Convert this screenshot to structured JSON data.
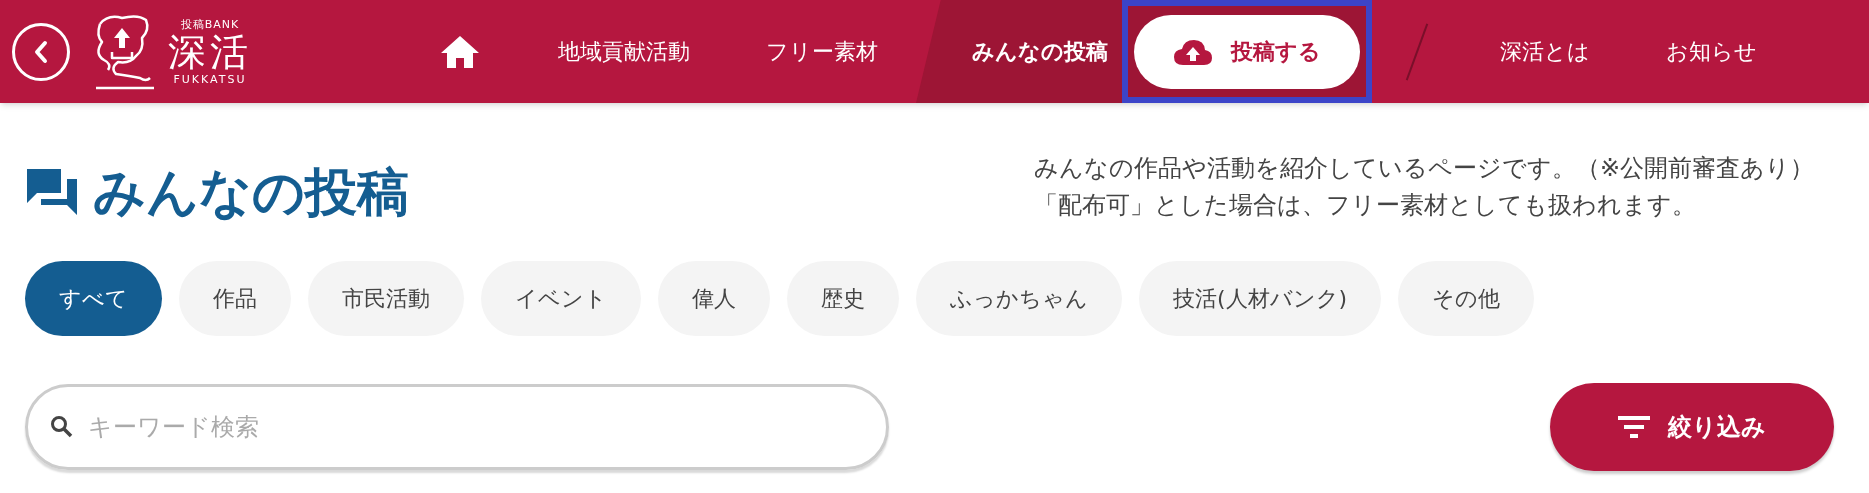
{
  "header": {
    "logo": {
      "tagline": "投稿BANK",
      "name": "深活",
      "romaji": "FUKKATSU"
    },
    "nav": [
      {
        "kind": "home"
      },
      {
        "kind": "link",
        "label": "地域貢献活動",
        "selected": false
      },
      {
        "kind": "link",
        "label": "フリー素材",
        "selected": false
      },
      {
        "kind": "link",
        "label": "みんなの投稿",
        "selected": true
      },
      {
        "kind": "cta",
        "label": "投稿する",
        "highlighted": true
      },
      {
        "kind": "divider"
      },
      {
        "kind": "link",
        "label": "深活とは",
        "selected": false
      },
      {
        "kind": "link",
        "label": "お知らせ",
        "selected": false
      }
    ]
  },
  "page": {
    "title": "みんなの投稿",
    "description": [
      "みんなの作品や活動を紹介しているページです。（※公開前審査あり）",
      "「配布可」とした場合は、フリー素材としても扱われます。"
    ]
  },
  "categories": [
    {
      "label": "すべて",
      "selected": true
    },
    {
      "label": "作品",
      "selected": false
    },
    {
      "label": "市民活動",
      "selected": false
    },
    {
      "label": "イベント",
      "selected": false
    },
    {
      "label": "偉人",
      "selected": false
    },
    {
      "label": "歴史",
      "selected": false
    },
    {
      "label": "ふっかちゃん",
      "selected": false
    },
    {
      "label": "技活(人材バンク)",
      "selected": false
    },
    {
      "label": "その他",
      "selected": false
    }
  ],
  "search": {
    "placeholder": "キーワード検索"
  },
  "filter_button": {
    "label": "絞り込み"
  }
}
